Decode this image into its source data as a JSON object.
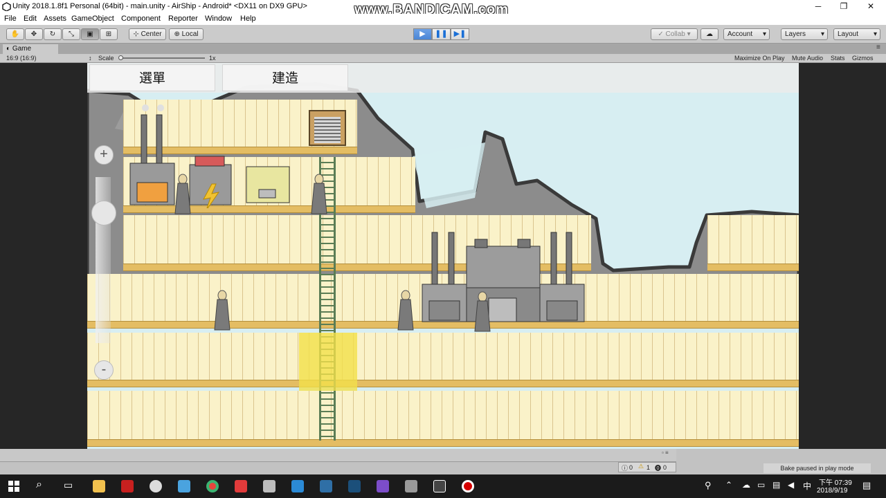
{
  "window": {
    "title": "Unity 2018.1.8f1 Personal (64bit) - main.unity - AirShip - Android* <DX11 on DX9 GPU>",
    "watermark": "www.BANDICAM.com",
    "controls": [
      "─",
      "❐",
      "✕"
    ]
  },
  "menu": [
    "File",
    "Edit",
    "Assets",
    "GameObject",
    "Component",
    "Reporter",
    "Window",
    "Help"
  ],
  "toolbar": {
    "pivot_center": "Center",
    "pivot_local": "Local",
    "collab": "Collab",
    "account": "Account",
    "layers": "Layers",
    "layout": "Layout"
  },
  "game_tab": {
    "tab_label": "Game",
    "aspect": "16:9 (16:9)",
    "scale_label": "Scale",
    "scale_value": "1x",
    "maximize": "Maximize On Play",
    "mute": "Mute Audio",
    "stats": "Stats",
    "gizmos": "Gizmos"
  },
  "game_ui": {
    "menu_button": "選單",
    "build_button": "建造",
    "zoom_in": "+",
    "zoom_out": "-"
  },
  "status": {
    "console_log": "0",
    "console_warn": "1",
    "console_error": "0",
    "bake_status": "Bake paused in play mode"
  },
  "taskbar": {
    "time": "下午 07:39",
    "date": "2018/9/19"
  },
  "colors": {
    "wall": "#faf2c9",
    "floor": "#e4bd63",
    "sky": "#d7eef2",
    "ladder": "#5b7d55",
    "highlight": "#f2e04a"
  }
}
